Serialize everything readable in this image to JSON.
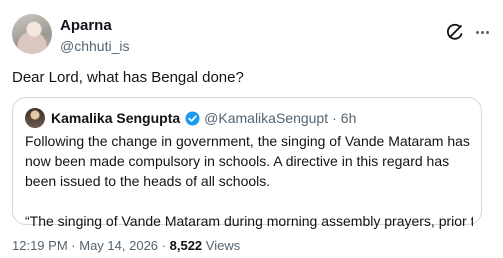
{
  "author": {
    "name": "Aparna",
    "handle": "@chhuti_is"
  },
  "tweet": {
    "text": "Dear Lord, what has Bengal done?"
  },
  "quote": {
    "name": "Kamalika Sengupta",
    "handle": "@KamalikaSengupt",
    "time": "6h",
    "paragraph1": "Following the change in government, the singing of Vande Mataram has now been made compulsory in schools. A directive in this regard has been issued to the heads of all schools.",
    "paragraph2": "“The singing of Vande Mataram during morning assembly prayers, prior to th..."
  },
  "meta": {
    "time": "12:19 PM",
    "date": "May 14, 2026",
    "views_count": "8,522",
    "views_label": "Views",
    "separator": "·"
  },
  "colors": {
    "text": "#0f1419",
    "secondary": "#536471",
    "border": "#cfd9de",
    "verified": "#1d9bf0"
  },
  "icons": {
    "grok": "grok-icon",
    "more": "more-horizontal-icon",
    "verified": "verified-badge-icon"
  }
}
